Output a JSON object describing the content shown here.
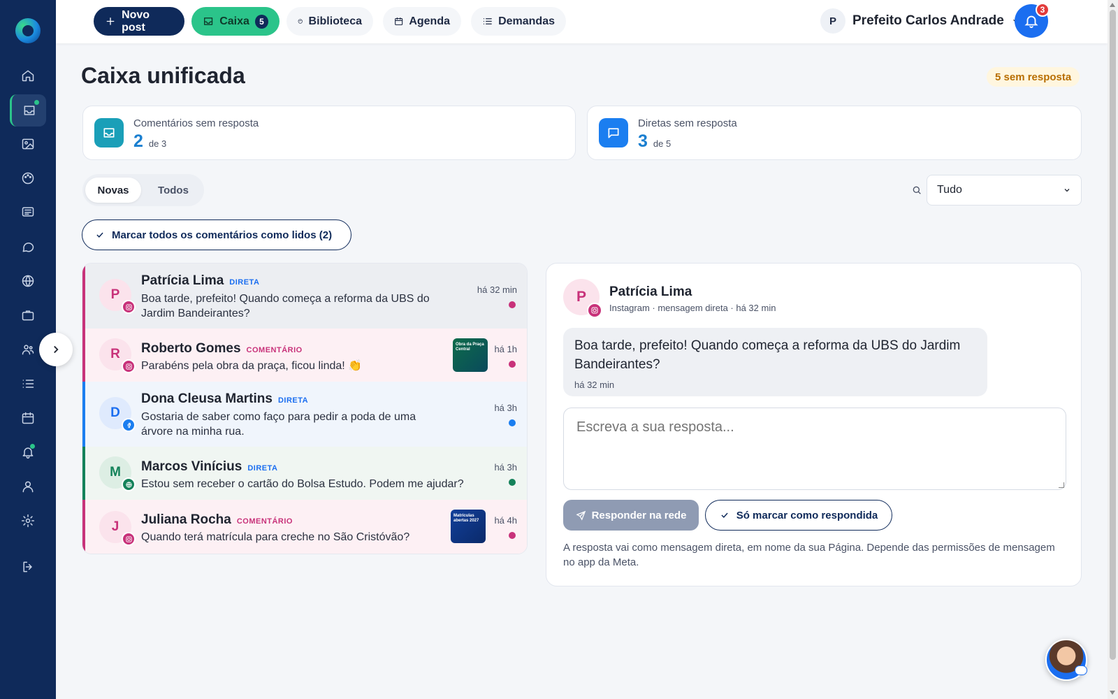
{
  "colors": {
    "navy": "#0f2a5a",
    "accent_green": "#2bc48a",
    "instagram": "#c8327a",
    "facebook": "#1b7ef0",
    "web": "#14825a",
    "bell": "#1b6ef0"
  },
  "sidebar": {
    "icons": [
      "home-icon",
      "inbox-icon",
      "image-icon",
      "palette-icon",
      "news-icon",
      "chat-icon",
      "globe-icon",
      "briefcase-icon",
      "users-icon",
      "list-icon",
      "calendar-icon",
      "bell-icon",
      "user-icon",
      "gear-icon",
      "logout-icon"
    ],
    "active": "inbox-icon"
  },
  "topbar": {
    "new_post": "Novo post",
    "caixa": "Caixa",
    "caixa_count": "5",
    "biblioteca": "Biblioteca",
    "agenda": "Agenda",
    "demandas": "Demandas",
    "user_initial": "P",
    "user_name": "Prefeito Carlos Andrade",
    "notifications": "3"
  },
  "page": {
    "title": "Caixa unificada",
    "unanswered": "5 sem resposta"
  },
  "stats": [
    {
      "label": "Comentários sem resposta",
      "value": "2",
      "of": "de 3"
    },
    {
      "label": "Diretas sem resposta",
      "value": "3",
      "of": "de 5"
    }
  ],
  "tabs": {
    "novas": "Novas",
    "todos": "Todos"
  },
  "filter": {
    "selected": "Tudo"
  },
  "mark_all": "Marcar todos os comentários como lidos (2)",
  "messages": [
    {
      "initial": "P",
      "name": "Patrícia Lima",
      "kind": "DIRETA",
      "text": "Boa tarde, prefeito! Quando começa a reforma da UBS do Jardim Bandeirantes?",
      "time": "há 32 min",
      "network": "instagram"
    },
    {
      "initial": "R",
      "name": "Roberto Gomes",
      "kind": "COMENTÁRIO",
      "text": "Parabéns pela obra da praça, ficou linda! 👏",
      "time": "há 1h",
      "network": "instagram",
      "thumb": "Obra da Praça Central"
    },
    {
      "initial": "D",
      "name": "Dona Cleusa Martins",
      "kind": "DIRETA",
      "text": "Gostaria de saber como faço para pedir a poda de uma árvore na minha rua.",
      "time": "há 3h",
      "network": "facebook"
    },
    {
      "initial": "M",
      "name": "Marcos Vinícius",
      "kind": "DIRETA",
      "text": "Estou sem receber o cartão do Bolsa Estudo. Podem me ajudar?",
      "time": "há 3h",
      "network": "web"
    },
    {
      "initial": "J",
      "name": "Juliana Rocha",
      "kind": "COMENTÁRIO",
      "text": "Quando terá matrícula para creche no São Cristóvão?",
      "time": "há 4h",
      "network": "instagram",
      "thumb": "Matrículas abertas 2027"
    }
  ],
  "detail": {
    "initial": "P",
    "name": "Patrícia Lima",
    "meta": "Instagram · mensagem direta · há 32 min",
    "message": "Boa tarde, prefeito! Quando começa a reforma da UBS do Jardim Bandeirantes?",
    "message_time": "há 32 min",
    "reply_placeholder": "Escreva a sua resposta...",
    "reply_button": "Responder na rede",
    "mark_button": "Só marcar como respondida",
    "note": "A resposta vai como mensagem direta, em nome da sua Página. Depende das permissões de mensagem no app da Meta."
  }
}
